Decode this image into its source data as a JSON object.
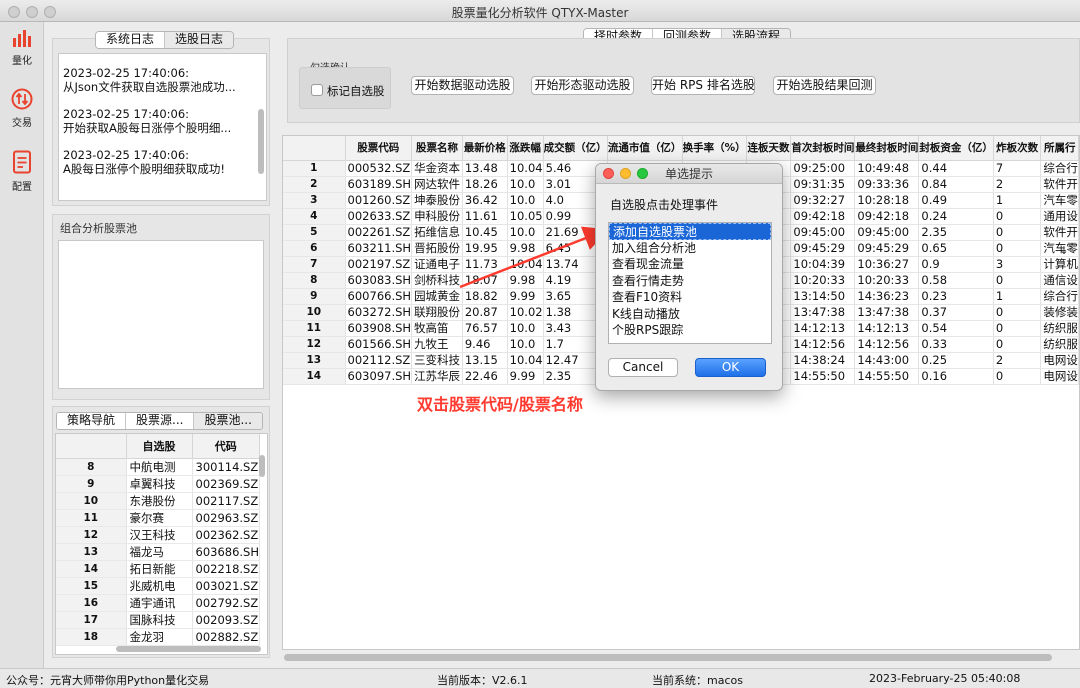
{
  "window": {
    "title": "股票量化分析软件 QTYX-Master"
  },
  "nav": [
    {
      "label": "量化",
      "icon": "bar-chart-icon",
      "color": "#e8432e"
    },
    {
      "label": "交易",
      "icon": "exchange-icon",
      "color": "#e8432e"
    },
    {
      "label": "配置",
      "icon": "document-icon",
      "color": "#e8432e"
    }
  ],
  "log_panel": {
    "tabs": [
      "系统日志",
      "选股日志"
    ],
    "entries": [
      {
        "time": "2023-02-25 17:40:06:",
        "text": "从Json文件获取自选股票池成功..."
      },
      {
        "time": "2023-02-25 17:40:06:",
        "text": "开始获取A股每日涨停个股明细..."
      },
      {
        "time": "2023-02-25 17:40:06:",
        "text": "A股每日涨停个股明细获取成功!"
      }
    ]
  },
  "pool_panel": {
    "title": "组合分析股票池"
  },
  "stock_list": {
    "tabs": [
      "策略导航",
      "股票源...",
      "股票池..."
    ],
    "headers": [
      "自选股",
      "代码"
    ],
    "rows": [
      {
        "n": "8",
        "name": "中航电测",
        "code": "300114.SZ"
      },
      {
        "n": "9",
        "name": "卓翼科技",
        "code": "002369.SZ"
      },
      {
        "n": "10",
        "name": "东港股份",
        "code": "002117.SZ"
      },
      {
        "n": "11",
        "name": "豪尔赛",
        "code": "002963.SZ"
      },
      {
        "n": "12",
        "name": "汉王科技",
        "code": "002362.SZ"
      },
      {
        "n": "13",
        "name": "福龙马",
        "code": "603686.SH"
      },
      {
        "n": "14",
        "name": "拓日新能",
        "code": "002218.SZ"
      },
      {
        "n": "15",
        "name": "兆威机电",
        "code": "003021.SZ"
      },
      {
        "n": "16",
        "name": "通宇通讯",
        "code": "002792.SZ"
      },
      {
        "n": "17",
        "name": "国脉科技",
        "code": "002093.SZ"
      },
      {
        "n": "18",
        "name": "金龙羽",
        "code": "002882.SZ"
      }
    ]
  },
  "top_tabs": [
    "择时参数",
    "回测参数",
    "选股流程"
  ],
  "toolbar": {
    "group_title": "勾选确认",
    "checkbox_label": "标记自选股",
    "buttons": [
      "开始数据驱动选股",
      "开始形态驱动选股",
      "开始 RPS 排名选股",
      "开始选股结果回测"
    ]
  },
  "main_table": {
    "headers": [
      "股票代码",
      "股票名称",
      "最新价格",
      "涨跌幅",
      "成交额（亿）",
      "流通市值（亿）",
      "换手率（%）",
      "连板天数",
      "首次封板时间",
      "最终封板时间",
      "封板资金（亿）",
      "炸板次数",
      "所属行"
    ],
    "rows": [
      [
        "1",
        "000532.SZ",
        "华金资本",
        "13.48",
        "10.04",
        "5.46",
        "",
        "",
        "",
        "09:25:00",
        "10:49:48",
        "0.44",
        "7",
        "综合行"
      ],
      [
        "2",
        "603189.SH",
        "网达软件",
        "18.26",
        "10.0",
        "3.01",
        "",
        "",
        "",
        "09:31:35",
        "09:33:36",
        "0.84",
        "2",
        "软件开"
      ],
      [
        "3",
        "001260.SZ",
        "坤泰股份",
        "36.42",
        "10.0",
        "4.0",
        "",
        "",
        "",
        "09:32:27",
        "10:28:18",
        "0.49",
        "1",
        "汽车零"
      ],
      [
        "4",
        "002633.SZ",
        "申科股份",
        "11.61",
        "10.05",
        "0.99",
        "",
        "",
        "",
        "09:42:18",
        "09:42:18",
        "0.24",
        "0",
        "通用设"
      ],
      [
        "5",
        "002261.SZ",
        "拓维信息",
        "10.45",
        "10.0",
        "21.69",
        "",
        "",
        "",
        "09:45:00",
        "09:45:00",
        "2.35",
        "0",
        "软件开"
      ],
      [
        "6",
        "603211.SH",
        "晋拓股份",
        "19.95",
        "9.98",
        "6.45",
        "",
        "",
        "",
        "09:45:29",
        "09:45:29",
        "0.65",
        "0",
        "汽车零"
      ],
      [
        "7",
        "002197.SZ",
        "证通电子",
        "11.73",
        "10.04",
        "13.74",
        "",
        "",
        "",
        "10:04:39",
        "10:36:27",
        "0.9",
        "3",
        "计算机"
      ],
      [
        "8",
        "603083.SH",
        "剑桥科技",
        "18.07",
        "9.98",
        "4.19",
        "",
        "",
        "",
        "10:20:33",
        "10:20:33",
        "0.58",
        "0",
        "通信设"
      ],
      [
        "9",
        "600766.SH",
        "园城黄金",
        "18.82",
        "9.99",
        "3.65",
        "",
        "",
        "",
        "13:14:50",
        "14:36:23",
        "0.23",
        "1",
        "综合行"
      ],
      [
        "10",
        "603272.SH",
        "联翔股份",
        "20.87",
        "10.02",
        "1.38",
        "",
        "",
        "",
        "13:47:38",
        "13:47:38",
        "0.37",
        "0",
        "装修装"
      ],
      [
        "11",
        "603908.SH",
        "牧高笛",
        "76.57",
        "10.0",
        "3.43",
        "",
        "",
        "",
        "14:12:13",
        "14:12:13",
        "0.54",
        "0",
        "纺织服"
      ],
      [
        "12",
        "601566.SH",
        "九牧王",
        "9.46",
        "10.0",
        "1.7",
        "",
        "",
        "",
        "14:12:56",
        "14:12:56",
        "0.33",
        "0",
        "纺织服"
      ],
      [
        "13",
        "002112.SZ",
        "三变科技",
        "13.15",
        "10.04",
        "12.47",
        "",
        "",
        "",
        "14:38:24",
        "14:43:00",
        "0.25",
        "2",
        "电网设"
      ],
      [
        "14",
        "603097.SH",
        "江苏华辰",
        "22.46",
        "9.99",
        "2.35",
        "",
        "",
        "",
        "14:55:50",
        "14:55:50",
        "0.16",
        "0",
        "电网设"
      ]
    ]
  },
  "annotation": "双击股票代码/股票名称",
  "dialog": {
    "title": "单选提示",
    "prompt": "自选股点击处理事件",
    "options": [
      "添加自选股票池",
      "加入组合分析池",
      "查看现金流量",
      "查看行情走势",
      "查看F10资料",
      "K线自动播放",
      "个股RPS跟踪"
    ],
    "selected_index": 0,
    "cancel": "Cancel",
    "ok": "OK"
  },
  "sort_indicator": "↓²",
  "status": {
    "left": "公众号：元宵大师带你用Python量化交易",
    "version": "当前版本：V2.6.1",
    "system": "当前系统：macos",
    "datetime": "2023-February-25 05:40:08"
  }
}
